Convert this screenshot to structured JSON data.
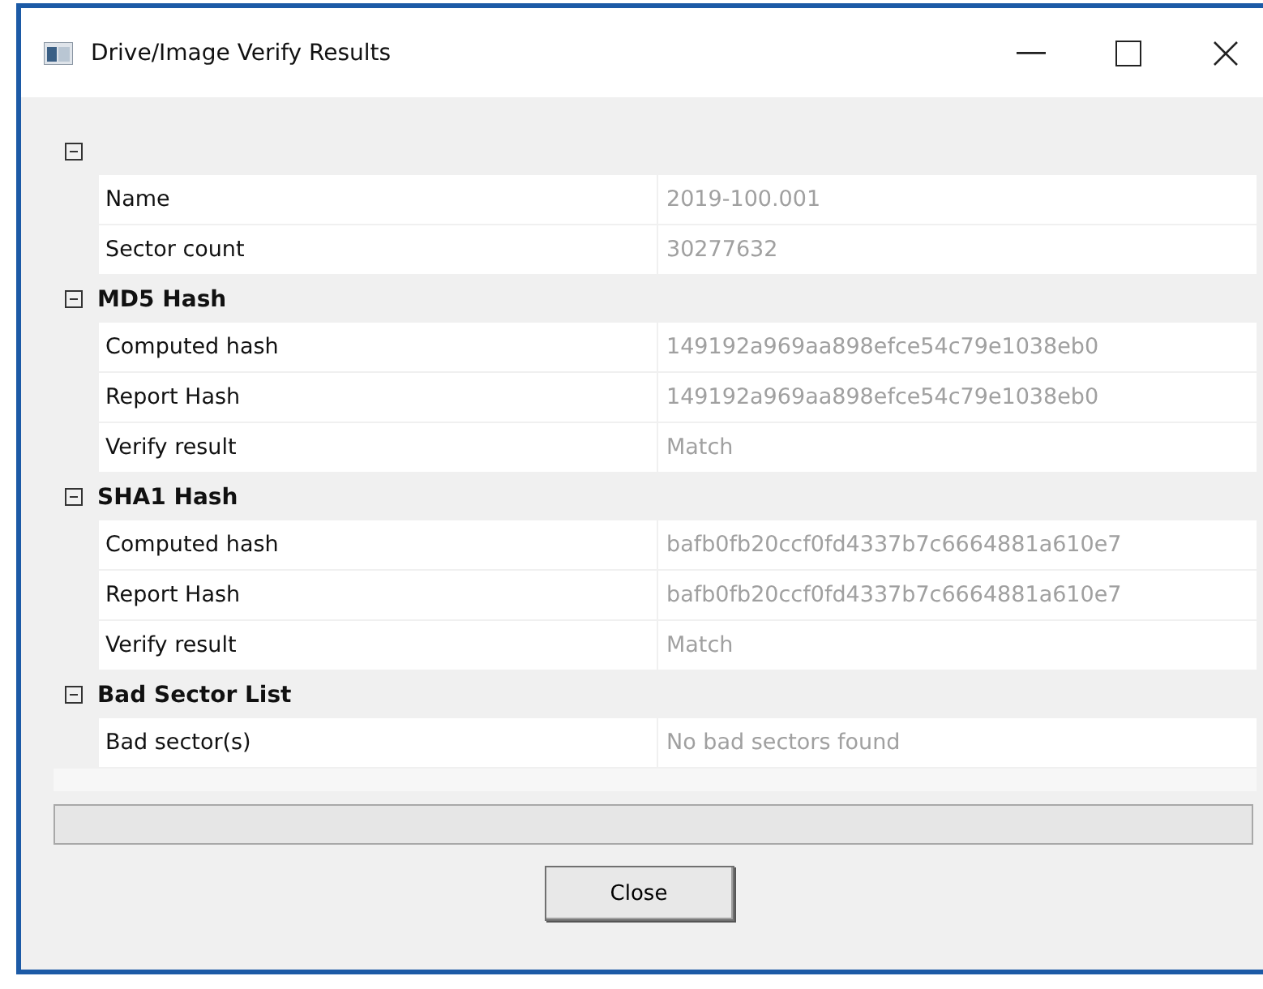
{
  "window": {
    "title": "Drive/Image Verify Results"
  },
  "groups": [
    {
      "expanded": true,
      "rows": [
        {
          "label": "Name",
          "value": "2019-100.001"
        },
        {
          "label": "Sector count",
          "value": "30277632"
        }
      ]
    },
    {
      "title": "MD5 Hash",
      "expanded": true,
      "rows": [
        {
          "label": "Computed hash",
          "value": "149192a969aa898efce54c79e1038eb0"
        },
        {
          "label": "Report Hash",
          "value": "149192a969aa898efce54c79e1038eb0"
        },
        {
          "label": "Verify result",
          "value": "Match"
        }
      ]
    },
    {
      "title": "SHA1 Hash",
      "expanded": true,
      "rows": [
        {
          "label": "Computed hash",
          "value": "bafb0fb20ccf0fd4337b7c6664881a610e7"
        },
        {
          "label": "Report Hash",
          "value": "bafb0fb20ccf0fd4337b7c6664881a610e7"
        },
        {
          "label": "Verify result",
          "value": "Match"
        }
      ]
    },
    {
      "title": "Bad Sector List",
      "expanded": true,
      "rows": [
        {
          "label": "Bad sector(s)",
          "value": "No bad sectors found"
        }
      ]
    }
  ],
  "progress": {
    "level": 0
  },
  "buttons": [
    "Close"
  ]
}
